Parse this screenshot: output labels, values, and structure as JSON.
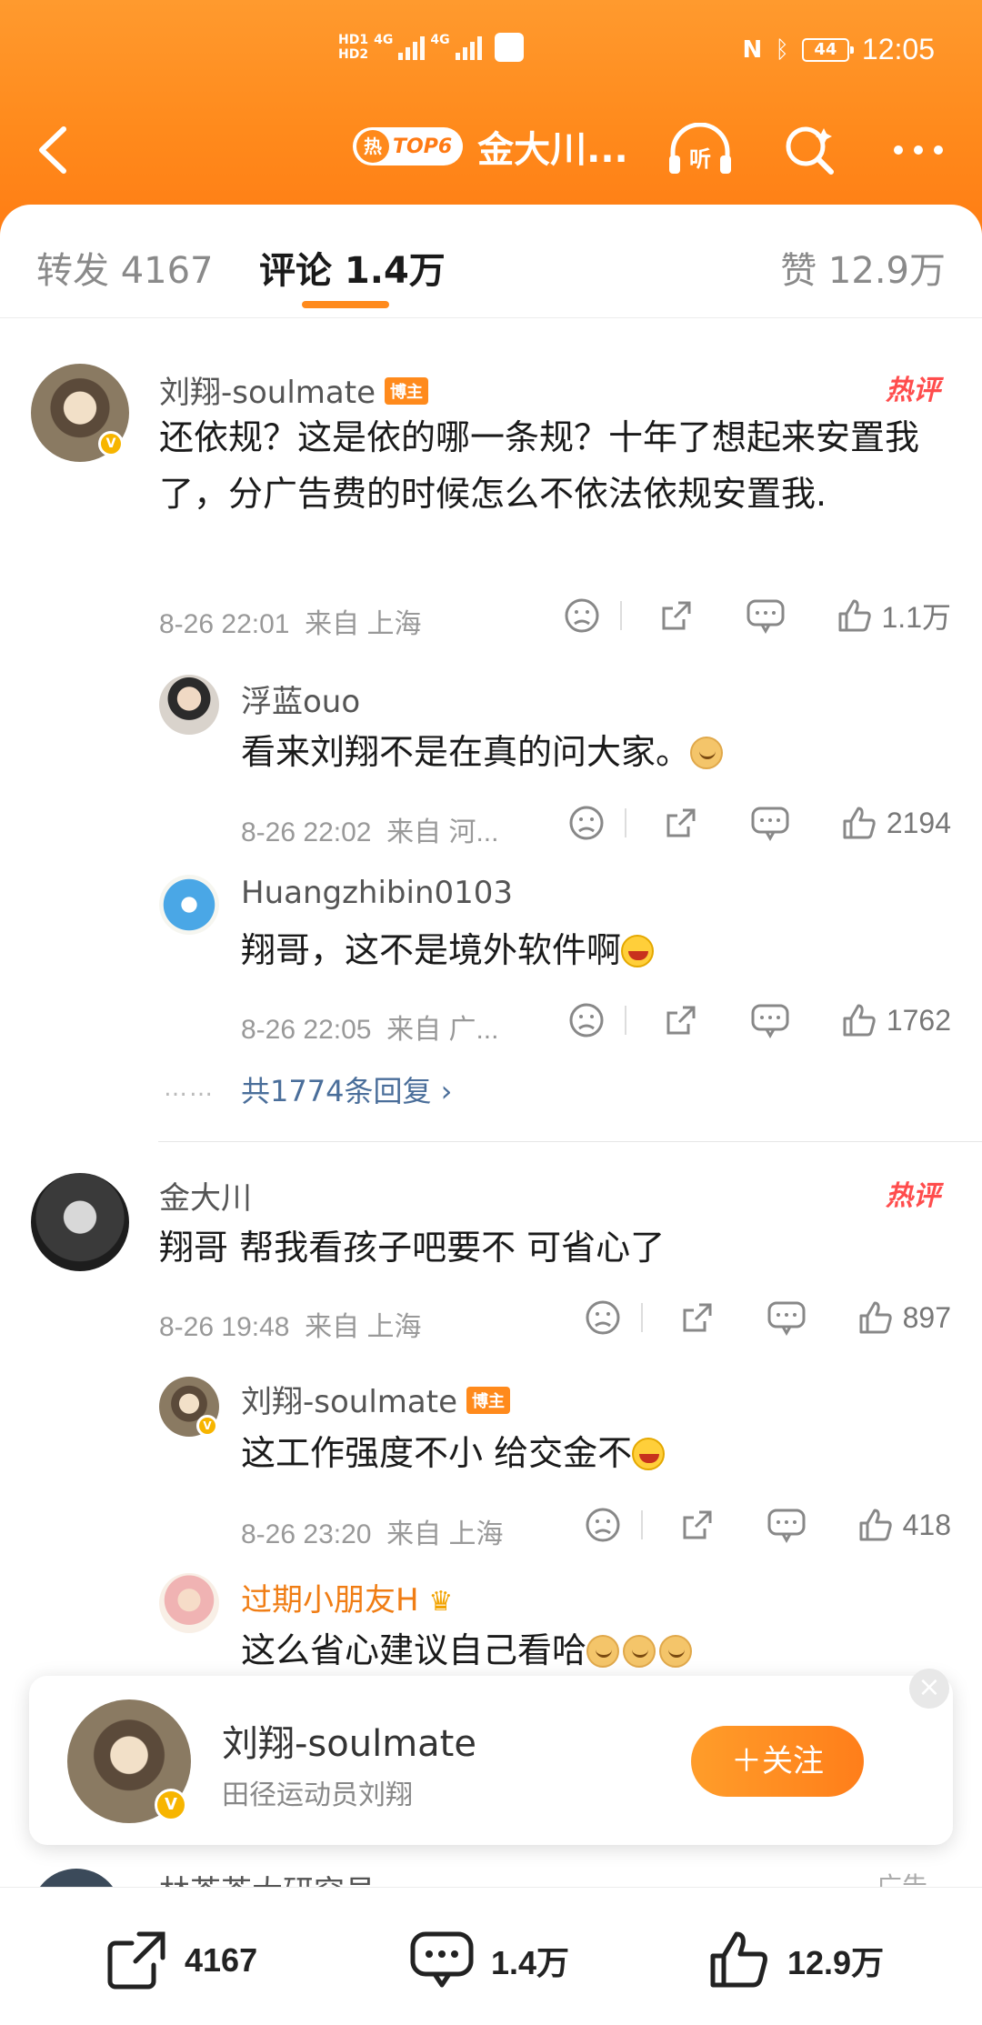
{
  "status_bar": {
    "hd1": "HD1",
    "hd2": "HD2",
    "net1": "4G",
    "net2": "4G",
    "battery": "44",
    "time": "12:05"
  },
  "navbar": {
    "hot_label": "热",
    "rank_label": "TOP6",
    "title": "金大川...",
    "icons": [
      "back-icon",
      "listen-icon",
      "search-icon",
      "more-icon"
    ]
  },
  "tabs": {
    "repost": "转发 4167",
    "comments": "评论 1.4万",
    "likes": "赞 12.9万"
  },
  "hot_tag": "热评",
  "bozhu_tag": "博主",
  "comments": [
    {
      "user": "刘翔-soulmate",
      "text": "还依规？这是依的哪一条规？十年了想起来安置我了，分广告费的时候怎么不依法依规安置我.",
      "time": "8-26 22:01",
      "from": "来自 上海",
      "likes": "1.1万",
      "replies": [
        {
          "user": "浮蓝ouo",
          "text": "看来刘翔不是在真的问大家。",
          "time": "8-26 22:02",
          "from": "来自 河...",
          "likes": "2194"
        },
        {
          "user": "Huangzhibin0103",
          "text": "翔哥，这不是境外软件啊",
          "time": "8-26 22:05",
          "from": "来自 广...",
          "likes": "1762"
        }
      ],
      "more_dots": "……",
      "more_replies": "共1774条回复"
    },
    {
      "user": "金大川",
      "text": "翔哥 帮我看孩子吧要不 可省心了",
      "time": "8-26 19:48",
      "from": "来自 上海",
      "likes": "897",
      "replies": [
        {
          "user": "刘翔-soulmate",
          "text": "这工作强度不小 给交金不",
          "time": "8-26 23:20",
          "from": "来自 上海",
          "likes": "418"
        },
        {
          "user": "过期小朋友H",
          "text": "这么省心建议自己看哈"
        }
      ]
    }
  ],
  "follow_card": {
    "name": "刘翔-soulmate",
    "desc": "田径运动员刘翔",
    "button": "＋关注",
    "close": "×"
  },
  "peek": {
    "name": "林茶茶大研究员",
    "ad": "广告"
  },
  "bottom_bar": {
    "repost": "4167",
    "comments": "1.4万",
    "likes": "12.9万"
  },
  "colors": {
    "accent": "#ff8a1c",
    "hot": "#ff4d4d",
    "link": "#4a6e9a"
  }
}
